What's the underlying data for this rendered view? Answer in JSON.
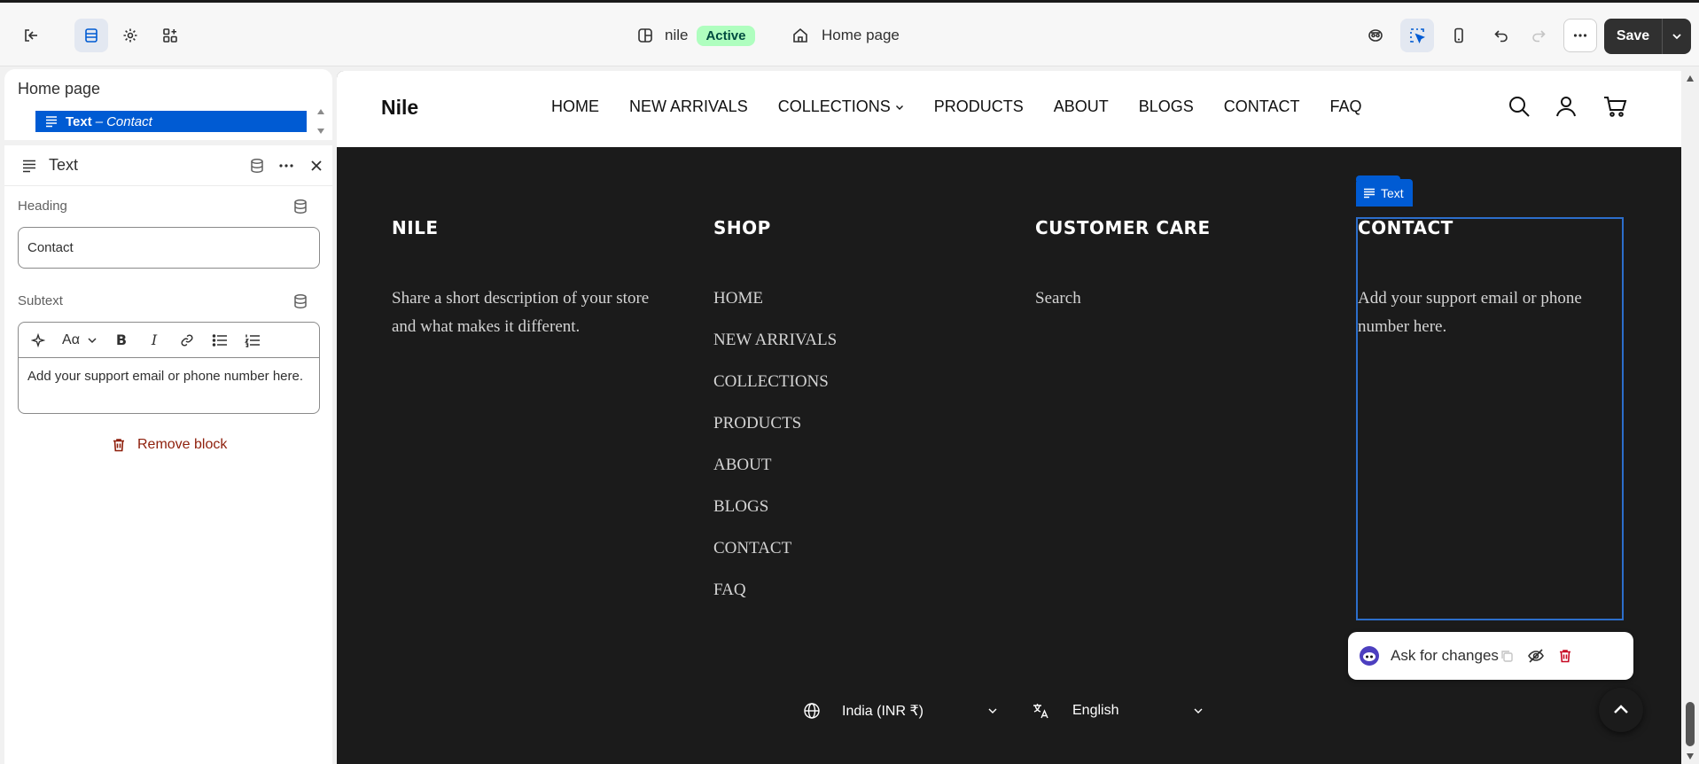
{
  "topbar": {
    "theme_name": "nile",
    "status_badge": "Active",
    "page_selector": "Home page",
    "save_label": "Save"
  },
  "sidebar": {
    "header": "Home page",
    "selected_item": {
      "type": "Text",
      "separator": "–",
      "name": "Contact"
    },
    "panel": {
      "title": "Text",
      "heading_label": "Heading",
      "heading_value": "Contact",
      "subtext_label": "Subtext",
      "subtext_value": "Add your support email or phone number here.",
      "remove_label": "Remove block"
    }
  },
  "preview": {
    "logo": "Nile",
    "nav": [
      "HOME",
      "NEW ARRIVALS",
      "COLLECTIONS",
      "PRODUCTS",
      "ABOUT",
      "BLOGS",
      "CONTACT",
      "FAQ"
    ],
    "footer": {
      "col1": {
        "heading": "NILE",
        "text": "Share a short description of your store and what makes it different."
      },
      "col2": {
        "heading": "SHOP",
        "links": [
          "HOME",
          "NEW ARRIVALS",
          "COLLECTIONS",
          "PRODUCTS",
          "ABOUT",
          "BLOGS",
          "CONTACT",
          "FAQ"
        ]
      },
      "col3": {
        "heading": "CUSTOMER CARE",
        "links": [
          "Search"
        ]
      },
      "col4": {
        "heading": "CONTACT",
        "text": "Add your support email or phone number here."
      }
    },
    "selection_tab": "Text",
    "ask_label": "Ask for changes",
    "country": "India (INR ₹)",
    "language": "English"
  },
  "colors": {
    "accent": "#005bd3",
    "footer_bg": "#1b1b1b",
    "badge_bg": "#affebf",
    "danger": "#8e1f0b"
  }
}
